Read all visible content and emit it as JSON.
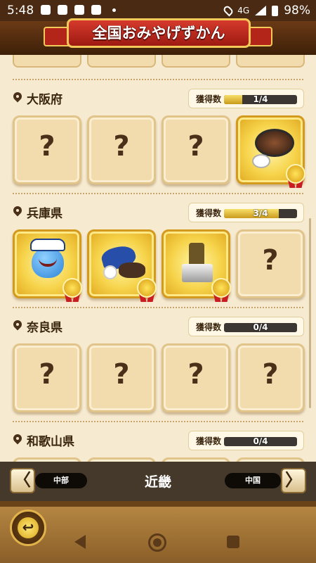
{
  "status_bar": {
    "time": "5:48",
    "network": "4G",
    "battery": "98%"
  },
  "title": "全国おみやげずかん",
  "sections": [
    {
      "name": "大阪府",
      "count_label": "獲得数",
      "count_text": "1/4",
      "progress": 0.25,
      "items": [
        {
          "state": "unknown",
          "symbol": "?"
        },
        {
          "state": "unknown",
          "symbol": "?"
        },
        {
          "state": "unknown",
          "symbol": "?"
        },
        {
          "state": "obtained",
          "art": "steak-plate"
        }
      ]
    },
    {
      "name": "兵庫県",
      "count_label": "獲得数",
      "count_text": "3/4",
      "progress": 0.75,
      "items": [
        {
          "state": "obtained",
          "art": "sailor-slime"
        },
        {
          "state": "obtained",
          "art": "baseball-bag"
        },
        {
          "state": "obtained",
          "art": "trophy-statue"
        },
        {
          "state": "unknown",
          "symbol": "?"
        }
      ]
    },
    {
      "name": "奈良県",
      "count_label": "獲得数",
      "count_text": "0/4",
      "progress": 0,
      "items": [
        {
          "state": "unknown",
          "symbol": "?"
        },
        {
          "state": "unknown",
          "symbol": "?"
        },
        {
          "state": "unknown",
          "symbol": "?"
        },
        {
          "state": "unknown",
          "symbol": "?"
        }
      ]
    },
    {
      "name": "和歌山県",
      "count_label": "獲得数",
      "count_text": "0/4",
      "progress": 0
    }
  ],
  "region_nav": {
    "prev_label": "中部",
    "current": "近畿",
    "next_label": "中国",
    "prev_arrow": "〈",
    "next_arrow": "〉"
  },
  "back_button_symbol": "↩",
  "colors": {
    "banner_red": "#c82a20",
    "gold": "#f6d34a",
    "parchment": "#f2dcae"
  }
}
